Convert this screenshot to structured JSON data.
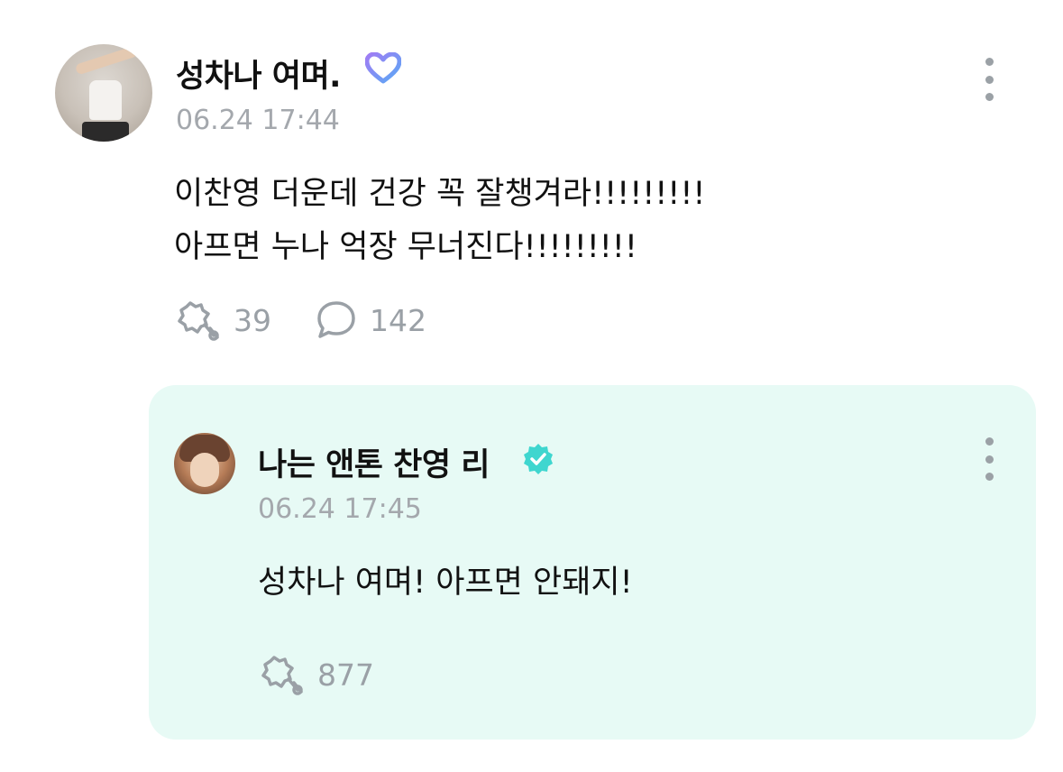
{
  "post": {
    "author": "성차나 여며.",
    "timestamp": "06.24 17:44",
    "body_lines": [
      "이찬영 더운데 건강 꼭 잘챙겨라!!!!!!!!!",
      "아프면 누나 억장 무너진다!!!!!!!!!"
    ],
    "cheer_count": "39",
    "comment_count": "142",
    "badge_icon": "heart-membership-icon",
    "colors": {
      "badge": "#7f6cf0"
    }
  },
  "reply": {
    "author": "나는 앤톤 찬영 리",
    "timestamp": "06.24 17:45",
    "body": "성차나 여며! 아프면 안돼지!",
    "cheer_count": "877",
    "badge_icon": "verified-check-icon",
    "colors": {
      "card_bg": "#e7faf5",
      "badge": "#3fd6cf"
    }
  }
}
